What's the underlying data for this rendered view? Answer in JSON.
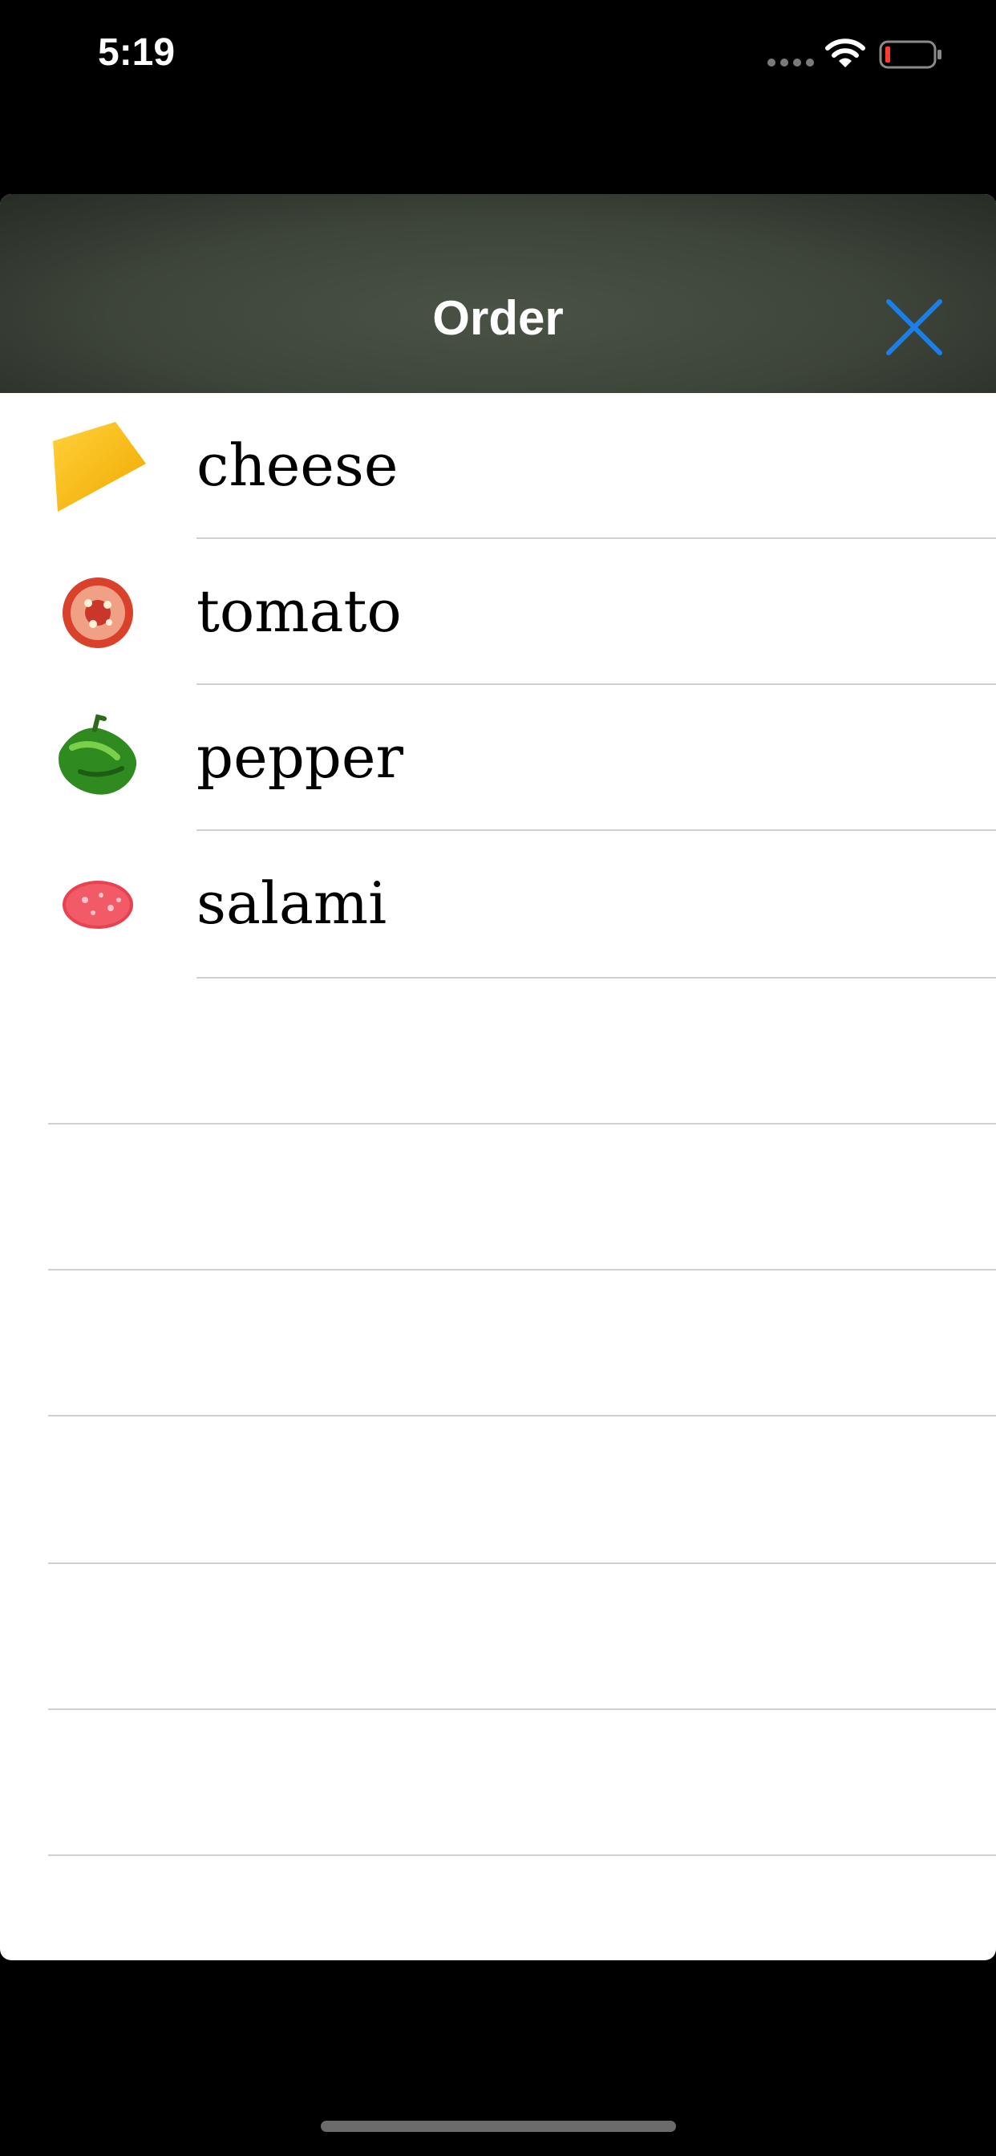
{
  "status_bar": {
    "time": "5:19",
    "battery_color": "#ff3b30"
  },
  "nav": {
    "title": "Order",
    "close_icon": "close-icon",
    "accent_color": "#1a80e8"
  },
  "items": [
    {
      "label": "cheese",
      "icon": "cheese-icon"
    },
    {
      "label": "tomato",
      "icon": "tomato-icon"
    },
    {
      "label": "pepper",
      "icon": "pepper-icon"
    },
    {
      "label": "salami",
      "icon": "salami-icon"
    }
  ]
}
